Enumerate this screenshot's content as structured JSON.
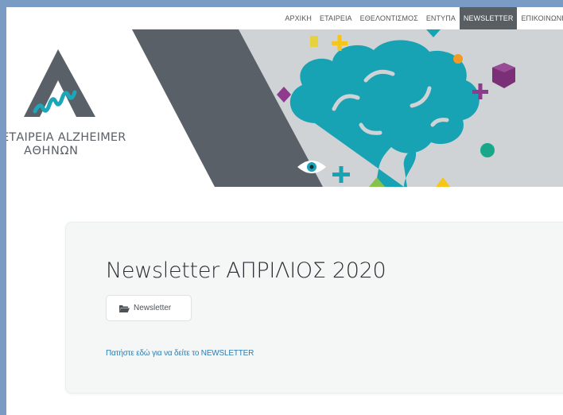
{
  "nav": {
    "items": [
      {
        "label": "ΑΡΧΙΚΗ",
        "active": false
      },
      {
        "label": "ΕΤΑΙΡΕΙΑ",
        "active": false
      },
      {
        "label": "ΕΘΕΛΟΝΤΙΣΜΟΣ",
        "active": false
      },
      {
        "label": "ΕΝΤΥΠΑ",
        "active": false
      },
      {
        "label": "NEWSLETTER",
        "active": true
      },
      {
        "label": "ΕΠΙΚΟΙΝΩΝΙΑ",
        "active": false
      }
    ]
  },
  "logo": {
    "line1": "ΕΤΑΙΡΕΙΑ ALZHEIMER",
    "line2": "ΑΘΗΝΩΝ"
  },
  "post": {
    "title": "Newsletter ΑΠΡΙΛΙΟΣ 2020",
    "category": "Newsletter",
    "category_icon": "folder-open-icon",
    "link_text": "Πατήστε εδώ για να δείτε το NEWSLETTER"
  },
  "colors": {
    "nav_active_bg": "#595e63",
    "brain": "#18a3b4",
    "dark_slab": "#5a6068",
    "banner_gray": "#cfd3d6",
    "link": "#2a7fb5"
  }
}
